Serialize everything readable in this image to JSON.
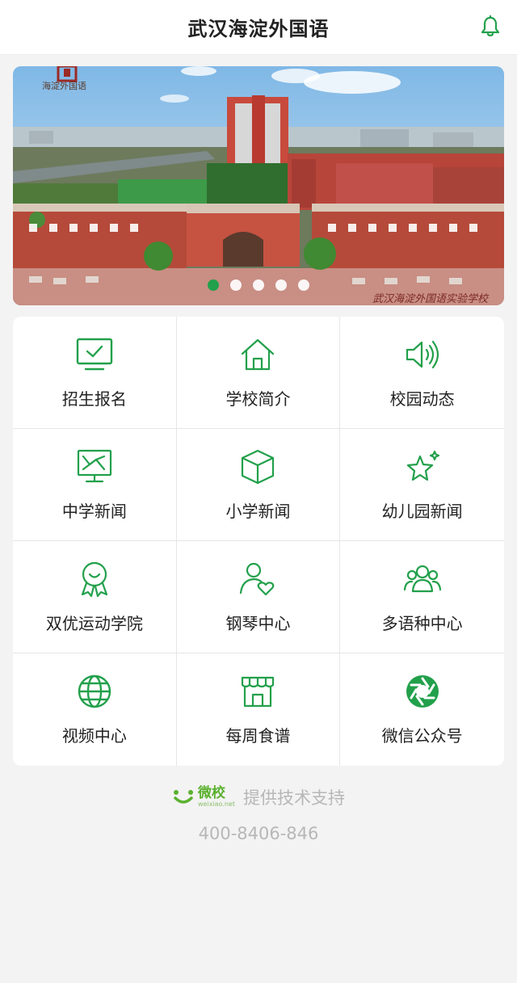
{
  "header": {
    "title": "武汉海淀外国语",
    "bell_icon": "bell-icon"
  },
  "banner": {
    "logo_text": "海淀外国语",
    "caption": "武汉海淀外国语实验学校",
    "slides": 5,
    "active_slide": 1
  },
  "menu": [
    {
      "label": "招生报名",
      "icon": "monitor-check-icon"
    },
    {
      "label": "学校简介",
      "icon": "home-icon"
    },
    {
      "label": "校园动态",
      "icon": "speaker-icon"
    },
    {
      "label": "中学新闻",
      "icon": "presentation-board-icon"
    },
    {
      "label": "小学新闻",
      "icon": "cube-icon"
    },
    {
      "label": "幼儿园新闻",
      "icon": "stars-icon"
    },
    {
      "label": "双优运动学院",
      "icon": "award-ribbon-icon"
    },
    {
      "label": "钢琴中心",
      "icon": "user-heart-icon"
    },
    {
      "label": "多语种中心",
      "icon": "group-icon"
    },
    {
      "label": "视频中心",
      "icon": "globe-icon"
    },
    {
      "label": "每周食谱",
      "icon": "shop-icon"
    },
    {
      "label": "微信公众号",
      "icon": "aperture-icon"
    }
  ],
  "footer": {
    "brand": "微校",
    "brand_sub": "weixiao.net",
    "support_text": "提供技术支持",
    "phone": "400-8406-846"
  },
  "colors": {
    "accent": "#22a04b",
    "brand": "#5bb12f"
  }
}
